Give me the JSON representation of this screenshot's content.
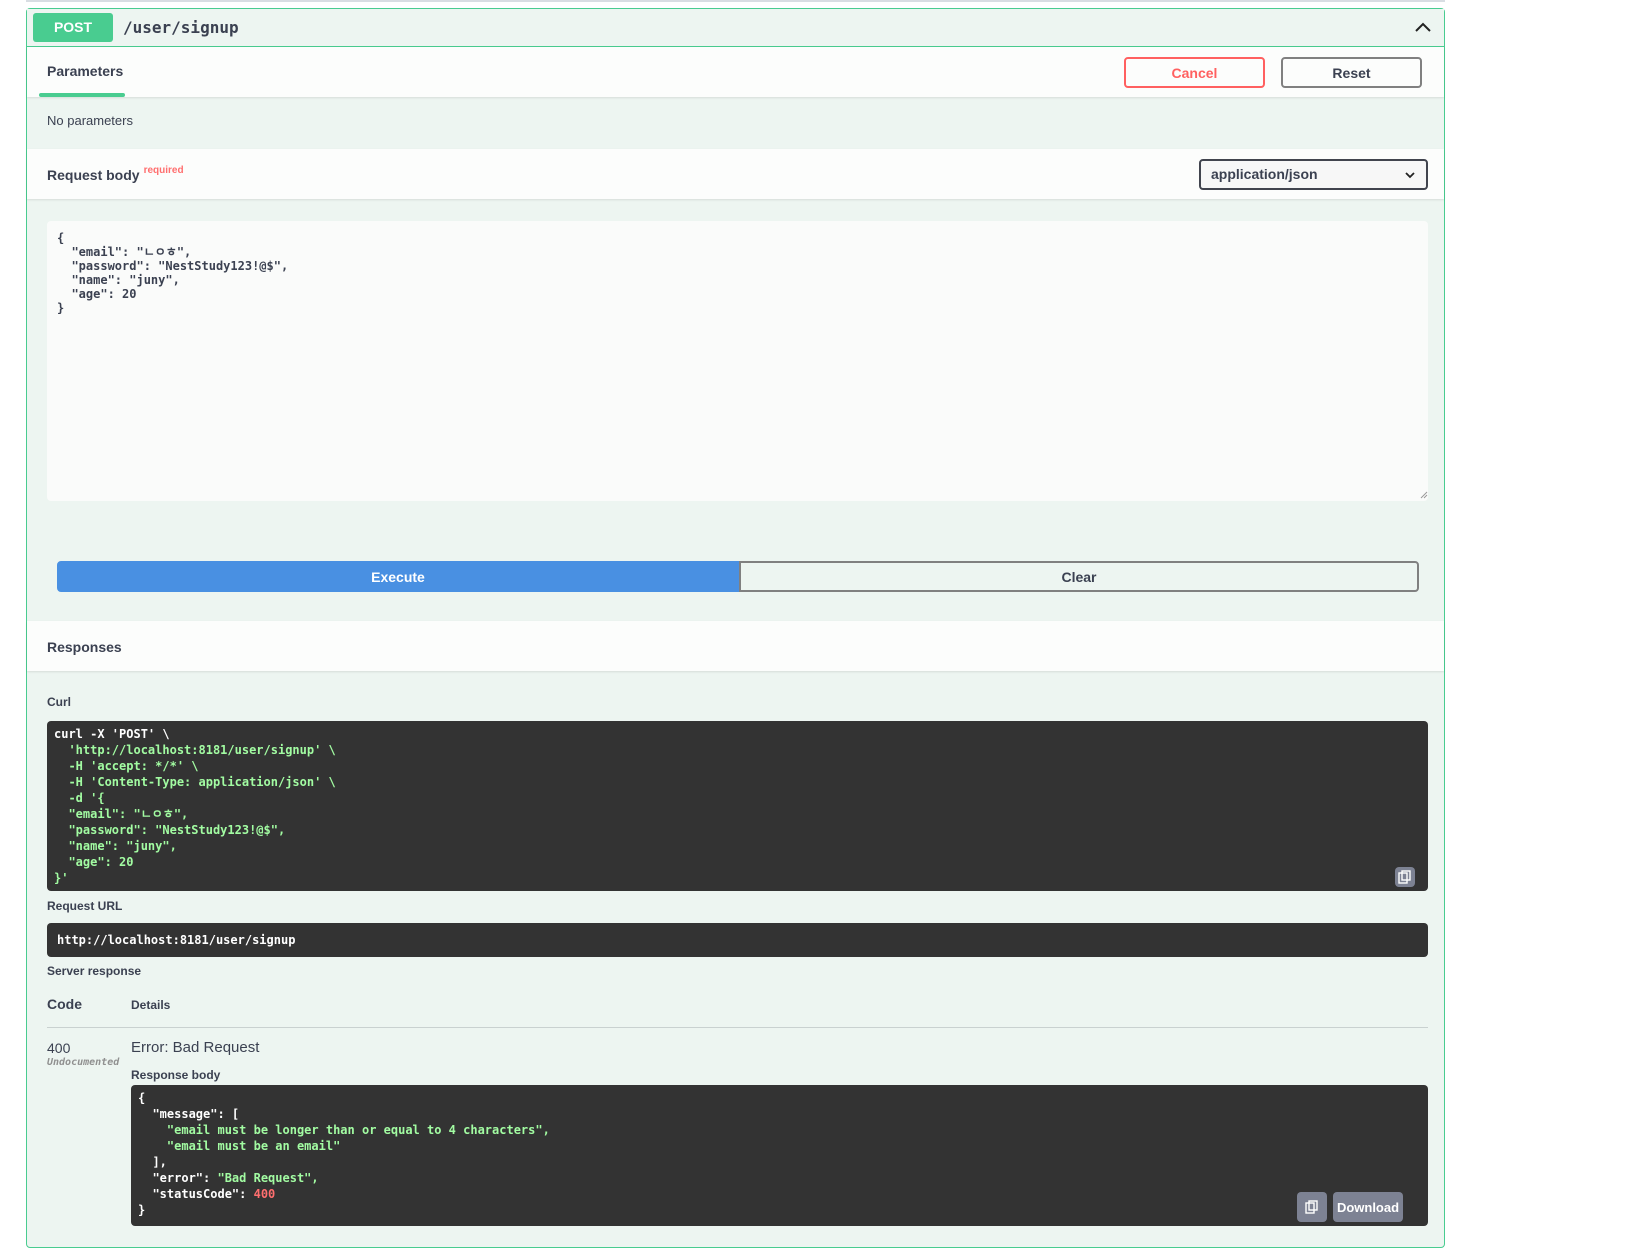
{
  "operation": {
    "method": "POST",
    "path": "/user/signup"
  },
  "parameters": {
    "tab_label": "Parameters",
    "cancel_label": "Cancel",
    "reset_label": "Reset",
    "empty_text": "No parameters"
  },
  "request_body": {
    "title": "Request body",
    "required_label": "required",
    "content_type": "application/json",
    "value": "{\n  \"email\": \"ㄴㅇㅎ\",\n  \"password\": \"NestStudy123!@$\",\n  \"name\": \"juny\",\n  \"age\": 20\n}"
  },
  "actions": {
    "execute_label": "Execute",
    "clear_label": "Clear"
  },
  "responses": {
    "title": "Responses",
    "curl_label": "Curl",
    "curl_lines": [
      "curl -X 'POST' \\",
      "  'http://localhost:8181/user/signup' \\",
      "  -H 'accept: */*' \\",
      "  -H 'Content-Type: application/json' \\",
      "  -d '{",
      "  \"email\": \"ㄴㅇㅎ\",",
      "  \"password\": \"NestStudy123!@$\",",
      "  \"name\": \"juny\",",
      "  \"age\": 20",
      "}'"
    ],
    "request_url_label": "Request URL",
    "request_url": "http://localhost:8181/user/signup",
    "server_response_label": "Server response",
    "col_code": "Code",
    "col_details": "Details",
    "status_code": "400",
    "undocumented_label": "Undocumented",
    "error_text": "Error: Bad Request",
    "response_body_label": "Response body",
    "response_body": {
      "messages": [
        "\"email must be longer than or equal to 4 characters\",",
        "\"email must be an email\""
      ],
      "error_value": "\"Bad Request\",",
      "status_code_value": "400"
    },
    "download_label": "Download"
  },
  "colors": {
    "post_green": "#49cc90",
    "execute_blue": "#4990e2",
    "cancel_red": "#ff6060",
    "code_bg": "#333333",
    "string_green": "#a2fca2"
  },
  "icons": {
    "collapse": "chevron-up-icon",
    "select": "chevron-down-icon",
    "copy": "copy-icon"
  }
}
